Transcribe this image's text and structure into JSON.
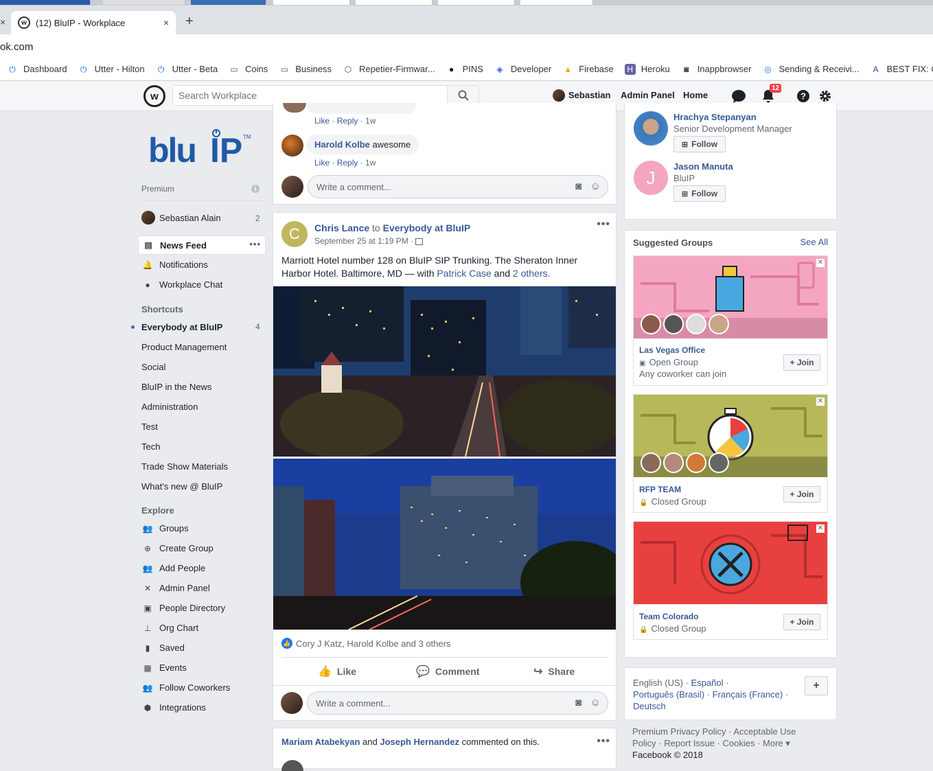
{
  "browser": {
    "tab_title": "(12) BluIP - Workplace",
    "tab_close": "×",
    "new_tab": "+",
    "url": "ok.com",
    "bookmarks": [
      {
        "label": "Dashboard",
        "icon": "power-icon"
      },
      {
        "label": "Utter - Hilton",
        "icon": "power-icon"
      },
      {
        "label": "Utter - Beta",
        "icon": "power-icon"
      },
      {
        "label": "Coins",
        "icon": "folder-icon"
      },
      {
        "label": "Business",
        "icon": "folder-icon"
      },
      {
        "label": "Repetier-Firmwar...",
        "icon": "repetier-icon"
      },
      {
        "label": "PINS",
        "icon": "github-icon"
      },
      {
        "label": "Developer",
        "icon": "developer-icon"
      },
      {
        "label": "Firebase",
        "icon": "firebase-icon"
      },
      {
        "label": "Heroku",
        "icon": "heroku-icon"
      },
      {
        "label": "Inappbrowser",
        "icon": "inappbrowser-icon"
      },
      {
        "label": "Sending & Receivi...",
        "icon": "sending-icon"
      },
      {
        "label": "BEST FIX: Car",
        "icon": "bestfix-icon"
      }
    ]
  },
  "header": {
    "search_placeholder": "Search Workplace",
    "user_name": "Sebastian",
    "admin_panel": "Admin Panel",
    "home": "Home",
    "notification_count": "12"
  },
  "leftnav": {
    "premium": "Premium",
    "profile_name": "Sebastian Alain",
    "profile_count": "2",
    "main_items": [
      {
        "label": "News Feed",
        "icon": "newsfeed-icon",
        "active": true
      },
      {
        "label": "Notifications",
        "icon": "bell-icon"
      },
      {
        "label": "Workplace Chat",
        "icon": "chat-icon"
      }
    ],
    "shortcuts_title": "Shortcuts",
    "shortcuts": [
      {
        "label": "Everybody at BluIP",
        "count": "4",
        "unread": true
      },
      {
        "label": "Product Management"
      },
      {
        "label": "Social"
      },
      {
        "label": "BluIP in the News"
      },
      {
        "label": "Administration"
      },
      {
        "label": "Test"
      },
      {
        "label": "Tech"
      },
      {
        "label": "Trade Show Materials"
      },
      {
        "label": "What's new @ BluIP"
      }
    ],
    "explore_title": "Explore",
    "explore": [
      {
        "label": "Groups",
        "icon": "groups-icon"
      },
      {
        "label": "Create Group",
        "icon": "plus-circle-icon"
      },
      {
        "label": "Add People",
        "icon": "add-people-icon"
      },
      {
        "label": "Admin Panel",
        "icon": "tools-icon"
      },
      {
        "label": "People Directory",
        "icon": "directory-icon"
      },
      {
        "label": "Org Chart",
        "icon": "org-chart-icon"
      },
      {
        "label": "Saved",
        "icon": "bookmark-icon"
      },
      {
        "label": "Events",
        "icon": "calendar-icon"
      },
      {
        "label": "Follow Coworkers",
        "icon": "follow-icon"
      },
      {
        "label": "Integrations",
        "icon": "cube-icon"
      }
    ]
  },
  "feed": {
    "prev_comment_meta": {
      "like": "Like",
      "reply": "Reply",
      "time": "1w"
    },
    "comment": {
      "author": "Harold Kolbe",
      "text": "awesome",
      "like": "Like",
      "reply": "Reply",
      "time": "1w"
    },
    "comment_placeholder": "Write a comment...",
    "post": {
      "author_initial": "C",
      "author": "Chris Lance",
      "to": "to",
      "target": "Everybody at BluIP",
      "timestamp": "September 25 at 1:19 PM ·",
      "text": "Marriott Hotel number 128 on BluIP SIP Trunking. The Sheraton Inner Harbor Hotel. Baltimore, MD — with",
      "tagged": "Patrick Case",
      "and": "and",
      "others": "2 others.",
      "reactions": "Cory J Katz, Harold Kolbe and 3 others",
      "like": "Like",
      "comment": "Comment",
      "share": "Share"
    },
    "next": {
      "person1": "Mariam Atabekyan",
      "and": "and",
      "person2": "Joseph Hernandez",
      "action": "commented on this."
    }
  },
  "right": {
    "people": [
      {
        "name": "Hrachya Stepanyan",
        "title": "Senior Development Manager",
        "follow": "Follow"
      },
      {
        "name": "Jason Manuta",
        "title": "BluIP",
        "initial": "J",
        "follow": "Follow"
      }
    ],
    "suggested_title": "Suggested Groups",
    "see_all": "See All",
    "groups": [
      {
        "name": "Las Vegas Office",
        "privacy": "Open Group",
        "note": "Any coworker can join",
        "join": "+ Join",
        "color": "#f4a6c1"
      },
      {
        "name": "RFP TEAM",
        "privacy": "Closed Group",
        "join": "+ Join",
        "color": "#b7b85a"
      },
      {
        "name": "Team Colorado",
        "privacy": "Closed Group",
        "join": "+ Join",
        "color": "#e8403f"
      }
    ],
    "languages": {
      "current": "English (US) ·",
      "others": [
        "Español ·",
        "Português (Brasil) ·",
        "Français (France) ·",
        "Deutsch"
      ]
    },
    "footer": {
      "line1": "Premium Privacy Policy · Acceptable Use",
      "line2": "Policy · Report Issue · Cookies · More ▾",
      "copyright": "Facebook © 2018"
    }
  }
}
